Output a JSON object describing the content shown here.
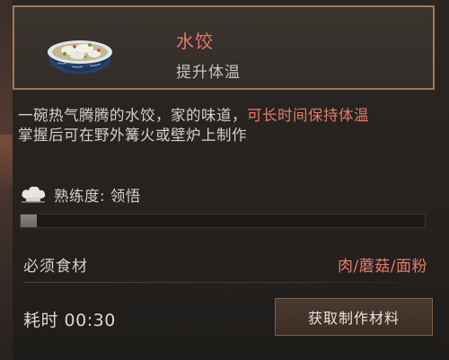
{
  "item": {
    "name": "水饺",
    "subtitle": "提升体温",
    "icon": "dumpling-bowl-icon"
  },
  "description": {
    "line1_normal": "一碗热气腾腾的水饺，家的味道，",
    "line1_highlight": "可长时间保持体温",
    "line2": "掌握后可在野外篝火或壁炉上制作"
  },
  "proficiency": {
    "label": "熟练度: 领悟",
    "icon": "chef-hat-icon",
    "progress": 0.04
  },
  "ingredients": {
    "label": "必须食材",
    "values": "肉/蘑菇/面粉"
  },
  "craft": {
    "time_label": "耗时 00:30",
    "button_label": "获取制作材料"
  },
  "colors": {
    "accent_red": "#e57a6b",
    "border_gold": "#a5784f",
    "text_light": "#d4cfc9"
  }
}
